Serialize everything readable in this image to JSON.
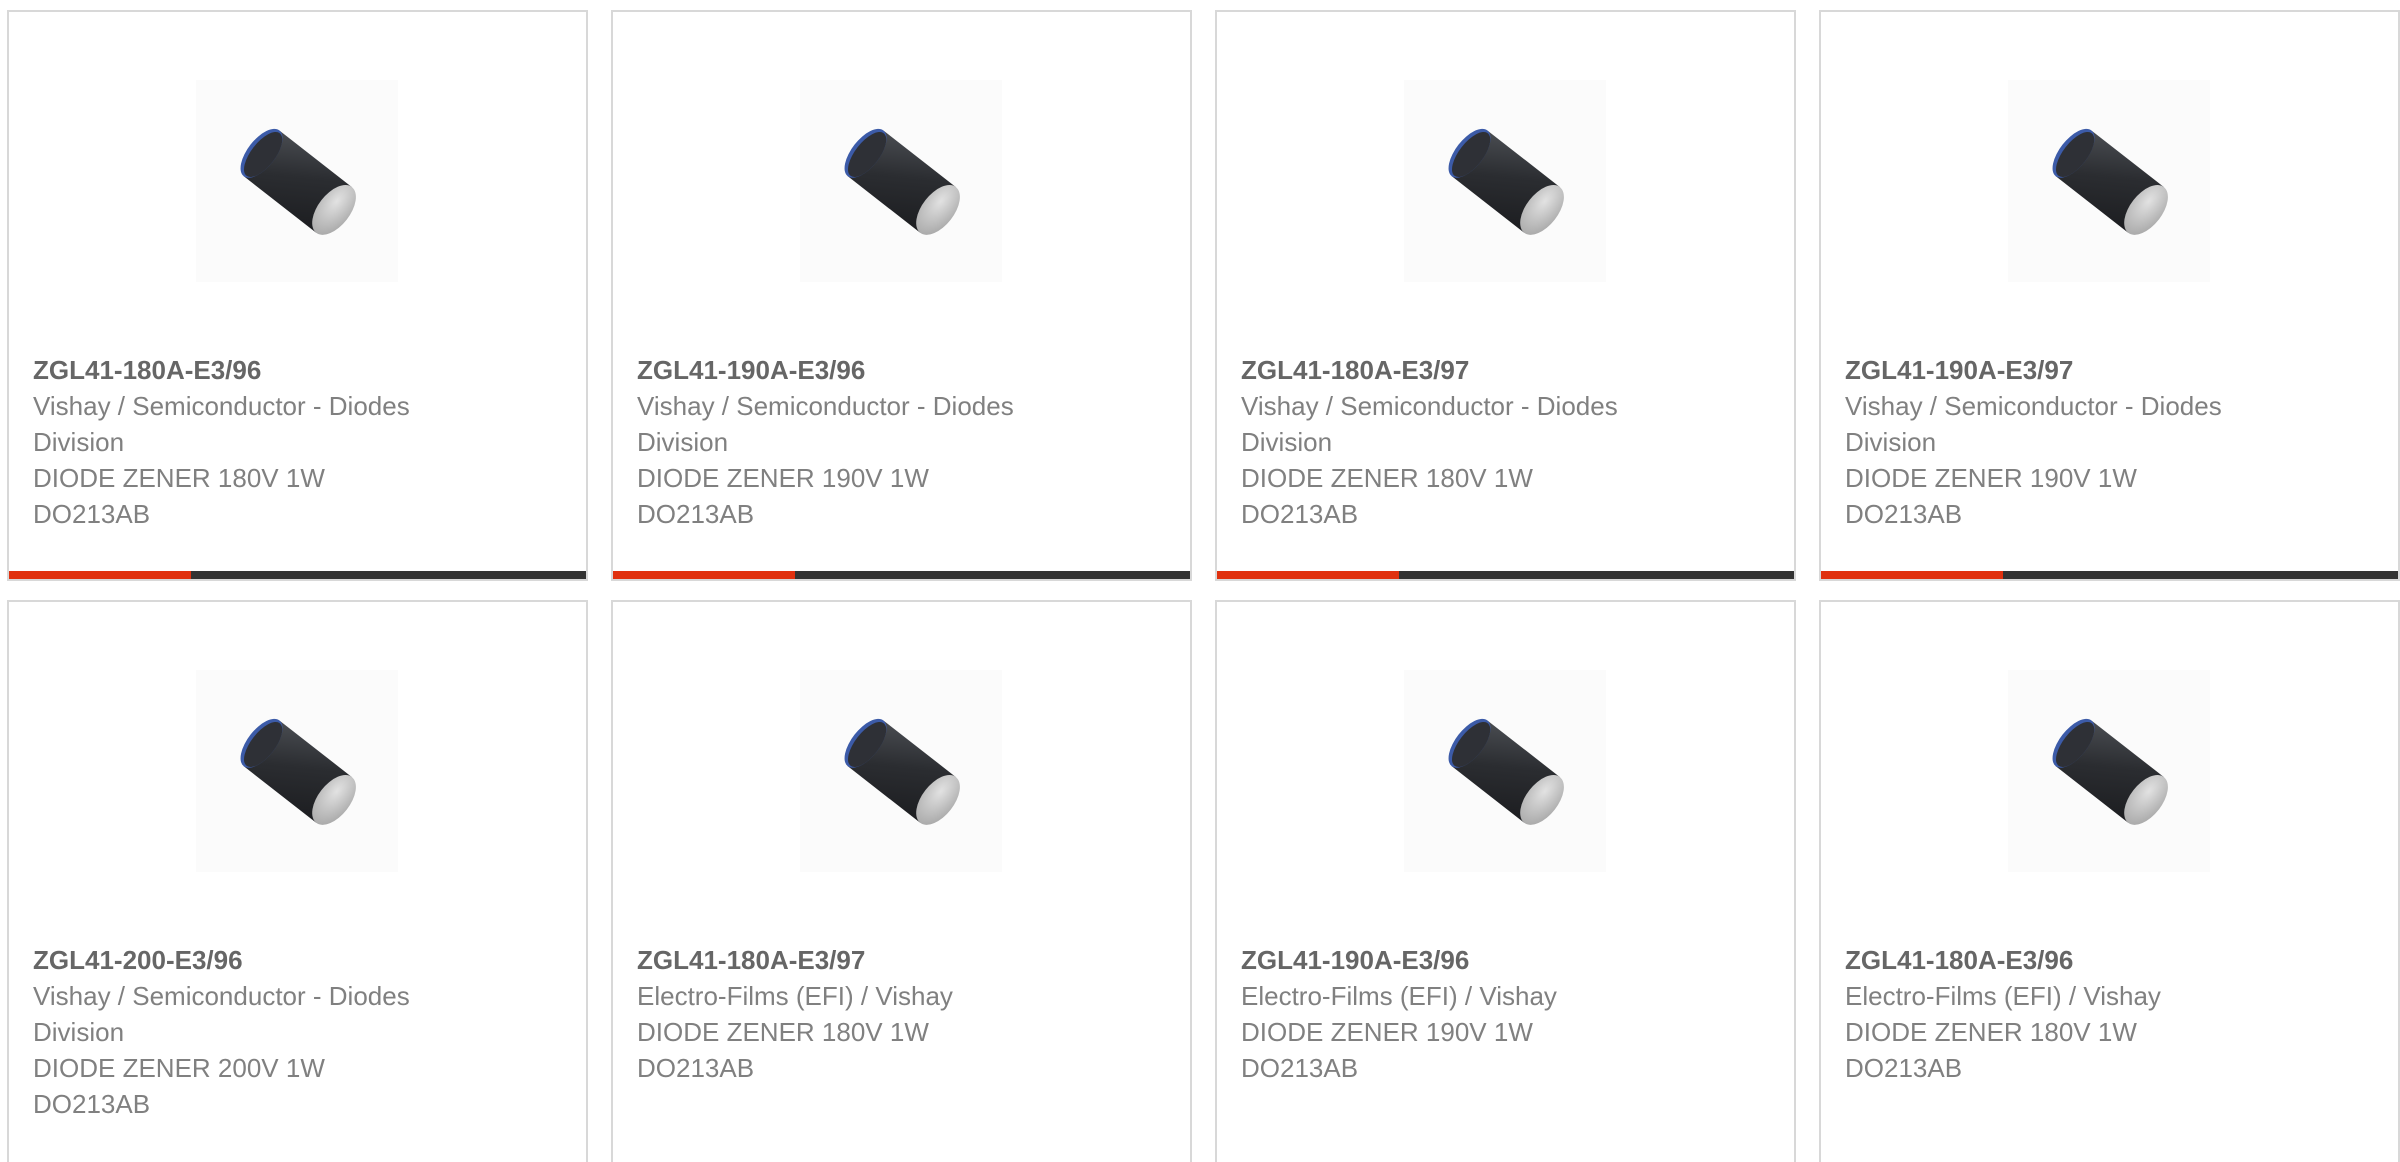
{
  "colors": {
    "accent": "#e0310f",
    "bar": "#333333",
    "border": "#d8d8d8",
    "part_text": "#666666",
    "body_text": "#808080"
  },
  "image_icon": "diode-do213ab-icon",
  "products": [
    {
      "part_number": "ZGL41-180A-E3/96",
      "manufacturer": "Vishay / Semiconductor - Diodes Division",
      "description_line1": "DIODE ZENER 180V 1W",
      "description_line2": "DO213AB",
      "has_bar": true
    },
    {
      "part_number": "ZGL41-190A-E3/96",
      "manufacturer": "Vishay / Semiconductor - Diodes Division",
      "description_line1": "DIODE ZENER 190V 1W",
      "description_line2": "DO213AB",
      "has_bar": true
    },
    {
      "part_number": "ZGL41-180A-E3/97",
      "manufacturer": "Vishay / Semiconductor - Diodes Division",
      "description_line1": "DIODE ZENER 180V 1W",
      "description_line2": "DO213AB",
      "has_bar": true
    },
    {
      "part_number": "ZGL41-190A-E3/97",
      "manufacturer": "Vishay / Semiconductor - Diodes Division",
      "description_line1": "DIODE ZENER 190V 1W",
      "description_line2": "DO213AB",
      "has_bar": true
    },
    {
      "part_number": "ZGL41-200-E3/96",
      "manufacturer": "Vishay / Semiconductor - Diodes Division",
      "description_line1": "DIODE ZENER 200V 1W",
      "description_line2": "DO213AB",
      "has_bar": false
    },
    {
      "part_number": "ZGL41-180A-E3/97",
      "manufacturer": "Electro-Films (EFI) / Vishay",
      "description_line1": "DIODE ZENER 180V 1W",
      "description_line2": "DO213AB",
      "has_bar": false
    },
    {
      "part_number": "ZGL41-190A-E3/96",
      "manufacturer": "Electro-Films (EFI) / Vishay",
      "description_line1": "DIODE ZENER 190V 1W",
      "description_line2": "DO213AB",
      "has_bar": false
    },
    {
      "part_number": "ZGL41-180A-E3/96",
      "manufacturer": "Electro-Films (EFI) / Vishay",
      "description_line1": "DIODE ZENER 180V 1W",
      "description_line2": "DO213AB",
      "has_bar": false
    }
  ]
}
